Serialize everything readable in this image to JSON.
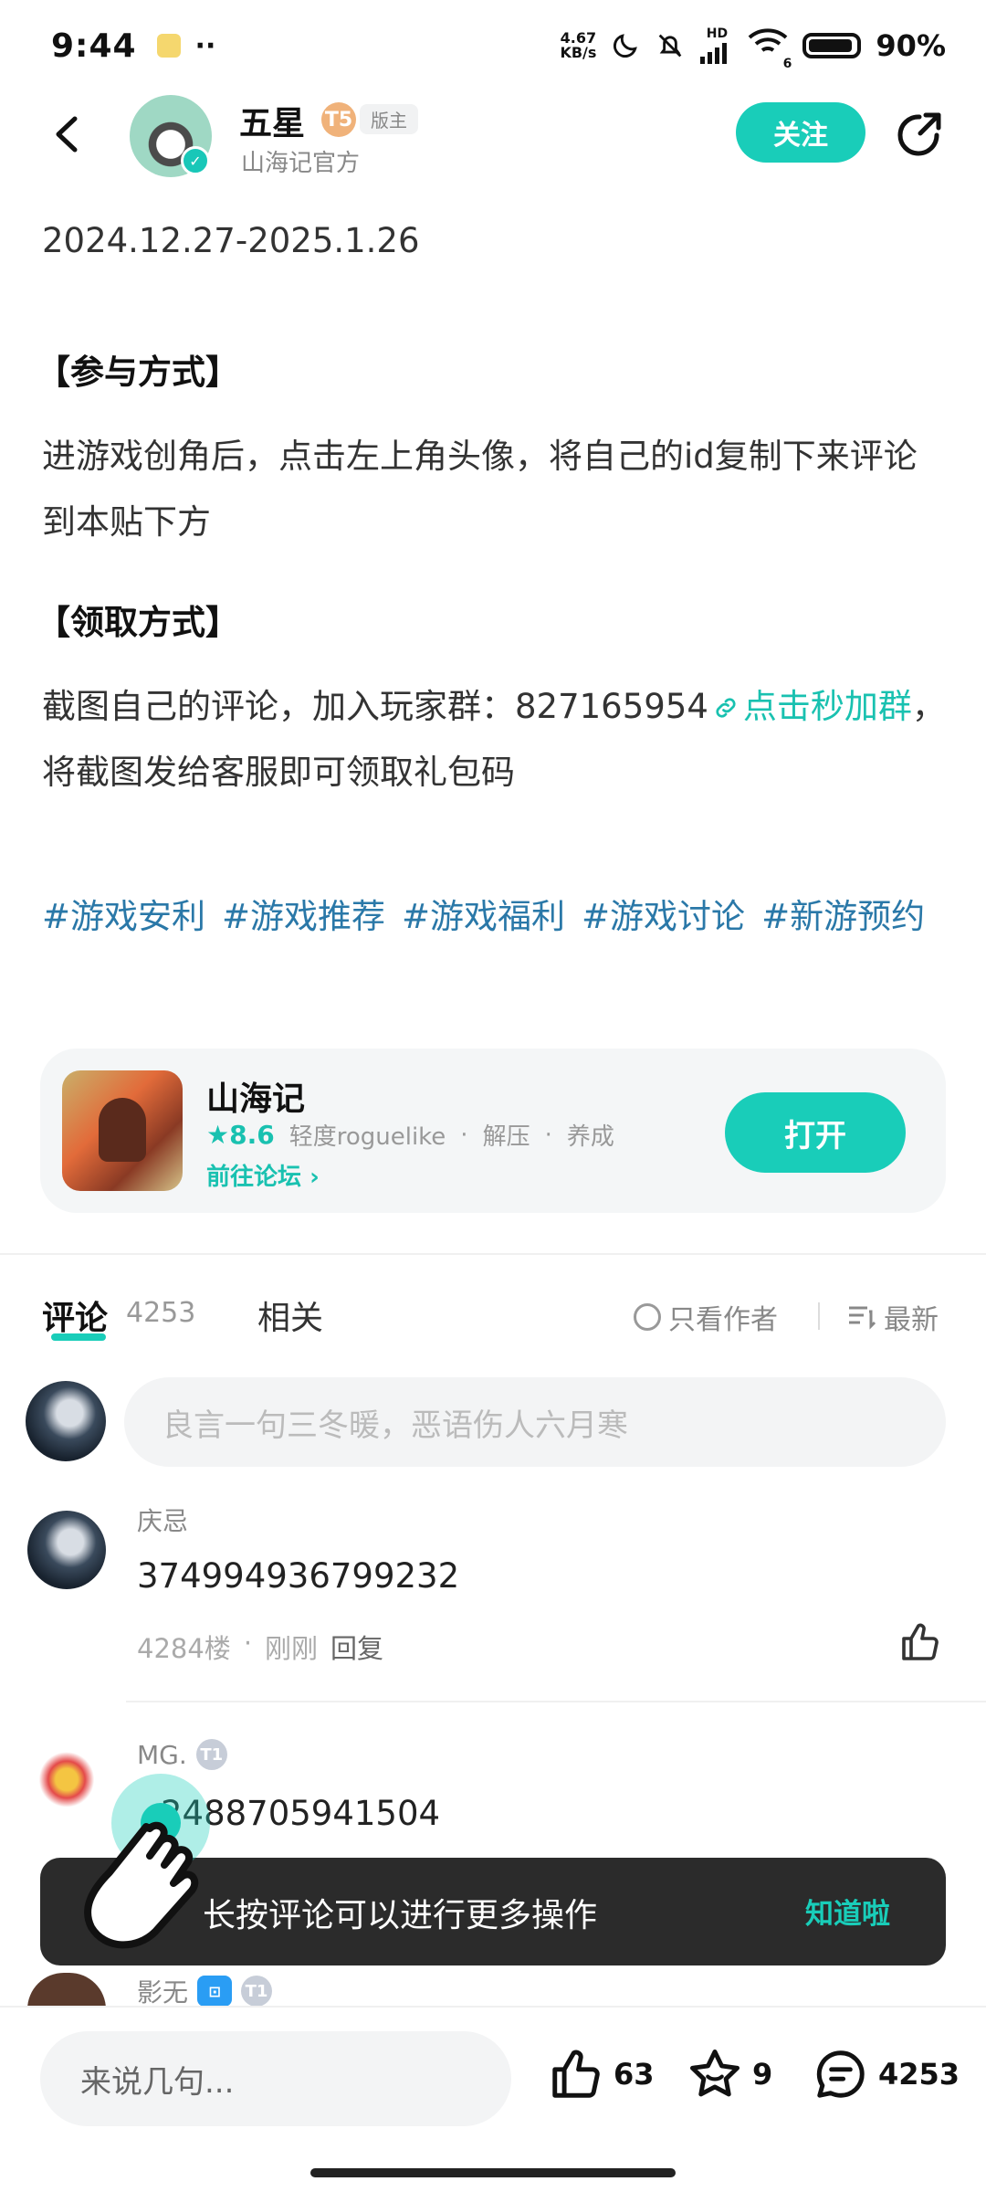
{
  "status_bar": {
    "time": "9:44",
    "dots": "··",
    "net_speed_value": "4.67",
    "net_speed_unit": "KB/s",
    "hd_label": "HD",
    "wifi_sub": "6",
    "battery": "90%"
  },
  "header": {
    "author_name": "五星",
    "level_badge": "T5",
    "role_badge": "版主",
    "author_sub": "山海记官方",
    "follow_label": "关注"
  },
  "post": {
    "date_range": "2024.12.27-2025.1.26",
    "section1_title": "【参与方式】",
    "section1_text": "进游戏创角后，点击左上角头像，将自己的id复制下来评论到本贴下方",
    "section2_title": "【领取方式】",
    "section2_text_before": "截图自己的评论，加入玩家群：827165954",
    "section2_link": "点击秒加群",
    "section2_text_after": "，将截图发给客服即可领取礼包码",
    "tags": [
      "#游戏安利",
      "#游戏推荐",
      "#游戏福利",
      "#游戏讨论",
      "#新游预约"
    ]
  },
  "game_card": {
    "name": "山海记",
    "score": "8.6",
    "tags": [
      "轻度roguelike",
      "解压",
      "养成"
    ],
    "forum_link": "前往论坛",
    "open_label": "打开"
  },
  "tabs": {
    "comment_label": "评论",
    "comment_count": "4253",
    "related_label": "相关",
    "only_author_label": "只看作者",
    "sort_label": "最新"
  },
  "comment_input": {
    "placeholder": "良言一句三冬暖，恶语伤人六月寒"
  },
  "comments": [
    {
      "name": "庆忌",
      "text": "374994936799232",
      "floor": "4284楼",
      "time": "刚刚",
      "reply": "回复"
    },
    {
      "name": "MG.",
      "badge": "T1",
      "text": "2488705941504"
    },
    {
      "name": "影无",
      "badge": "T1"
    }
  ],
  "toast": {
    "text": "长按评论可以进行更多操作",
    "button": "知道啦"
  },
  "bottom_bar": {
    "input_placeholder": "来说几句...",
    "likes": "63",
    "favorites": "9",
    "comments": "4253"
  },
  "colors": {
    "accent": "#19cdb9",
    "tag_blue": "#2a78a8",
    "toast_bg": "#2b2b2b"
  },
  "icons": [
    "back-arrow-icon",
    "share-icon",
    "verified-icon",
    "star-icon",
    "link-icon",
    "chevron-right-icon",
    "radio-circle-icon",
    "sort-icon",
    "thumb-up-icon",
    "star-outline-icon",
    "chat-bubble-icon",
    "hand-pointer-icon"
  ]
}
